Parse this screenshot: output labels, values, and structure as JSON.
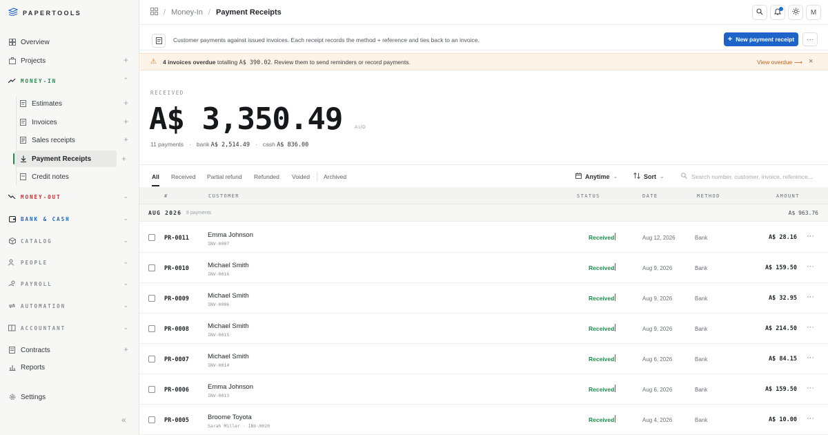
{
  "app": {
    "brand": "PAPERTOOLS"
  },
  "sidebar": {
    "overview": "Overview",
    "projects": "Projects",
    "money_in": "MONEY-IN",
    "estimates": "Estimates",
    "invoices": "Invoices",
    "sales_receipts": "Sales receipts",
    "payment_receipts": "Payment Receipts",
    "credit_notes": "Credit notes",
    "money_out": "MONEY-OUT",
    "bank_cash": "BANK & CASH",
    "catalog": "CATALOG",
    "people": "PEOPLE",
    "payroll": "PAYROLL",
    "automation": "AUTOMATION",
    "accountant": "ACCOUNTANT",
    "contracts": "Contracts",
    "reports": "Reports",
    "settings": "Settings",
    "colors": {
      "money_in": "#1f8a4c",
      "money_out": "#d22b2b",
      "bank_cash": "#1d63c8"
    }
  },
  "breadcrumb": {
    "section": "Money-In",
    "current": "Payment Receipts"
  },
  "topbar": {
    "avatar": "M"
  },
  "info": {
    "description": "Customer payments against issued invoices. Each receipt records the method + reference and ties back to an invoice.",
    "new_button": "New payment receipt"
  },
  "alert": {
    "bold": "4 invoices overdue",
    "text1": " totalling ",
    "amount": "A$ 390.02",
    "text2": ". Review them to send reminders or record payments.",
    "action": "View overdue ⟶"
  },
  "summary": {
    "label": "RECEIVED",
    "amount": "A$ 3,350.49",
    "currency": "AUD",
    "payments": "11 payments",
    "bank_label": "bank",
    "bank_value": "A$ 2,514.49",
    "cash_label": "cash",
    "cash_value": "A$ 836.00"
  },
  "tabs": [
    "All",
    "Received",
    "Partial refund",
    "Refunded",
    "Voided",
    "Archived"
  ],
  "filters": {
    "date": "Anytime",
    "sort": "Sort",
    "search_placeholder": "Search number, customer, invoice, reference..."
  },
  "table": {
    "headers": {
      "num": "#",
      "customer": "CUSTOMER",
      "status": "STATUS",
      "date": "DATE",
      "method": "METHOD",
      "amount": "AMOUNT"
    },
    "group": {
      "label": "AUG 2026",
      "count": "8 payments",
      "total": "A$ 963.76"
    },
    "rows": [
      {
        "num": "PR-0011",
        "customer": "Emma Johnson",
        "invoice": "INV-0007",
        "status": "Received",
        "date": "Aug 12, 2026",
        "method": "Bank",
        "amount": "A$ 28.16"
      },
      {
        "num": "PR-0010",
        "customer": "Michael Smith",
        "invoice": "INV-0016",
        "status": "Received",
        "date": "Aug 9, 2026",
        "method": "Bank",
        "amount": "A$ 159.50"
      },
      {
        "num": "PR-0009",
        "customer": "Michael Smith",
        "invoice": "INV-0006",
        "status": "Received",
        "date": "Aug 9, 2026",
        "method": "Bank",
        "amount": "A$ 32.95"
      },
      {
        "num": "PR-0008",
        "customer": "Michael Smith",
        "invoice": "INV-0015",
        "status": "Received",
        "date": "Aug 9, 2026",
        "method": "Bank",
        "amount": "A$ 214.50"
      },
      {
        "num": "PR-0007",
        "customer": "Michael Smith",
        "invoice": "INV-0014",
        "status": "Received",
        "date": "Aug 6, 2026",
        "method": "Bank",
        "amount": "A$ 84.15"
      },
      {
        "num": "PR-0006",
        "customer": "Emma Johnson",
        "invoice": "INV-0013",
        "status": "Received",
        "date": "Aug 6, 2026",
        "method": "Bank",
        "amount": "A$ 159.50"
      },
      {
        "num": "PR-0005",
        "customer": "Broome Toyota",
        "invoice": "Sarah Miller  ·  INV-0020",
        "status": "Received",
        "date": "Aug 4, 2026",
        "method": "Bank",
        "amount": "A$ 10.00"
      }
    ]
  }
}
